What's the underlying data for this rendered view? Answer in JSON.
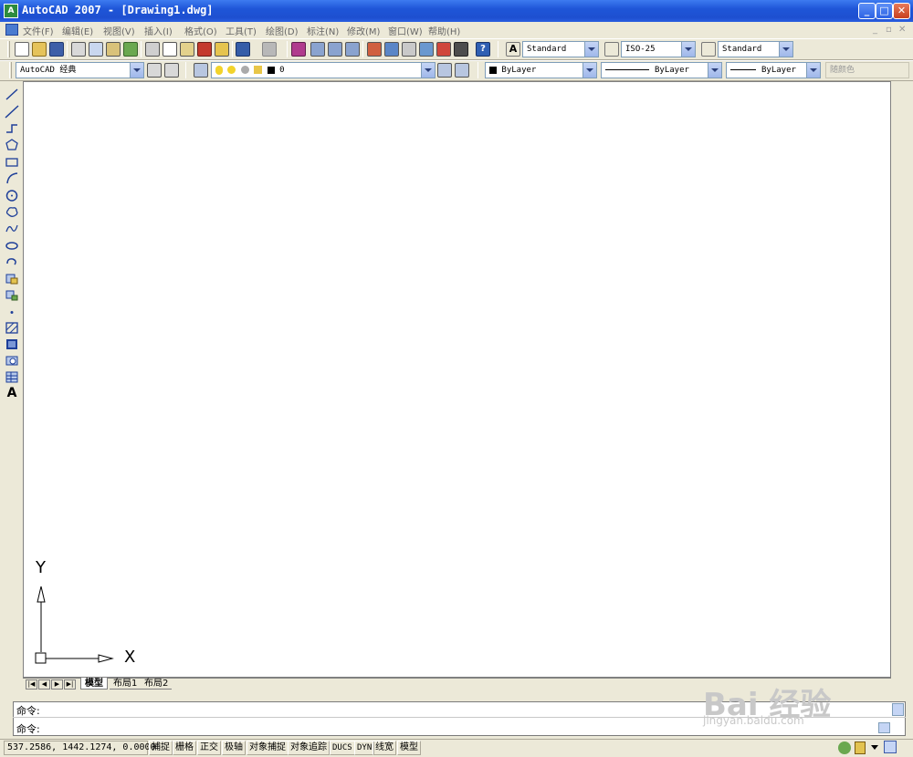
{
  "window": {
    "title": "AutoCAD 2007 - [Drawing1.dwg]"
  },
  "menu": {
    "items": [
      "文件(F)",
      "编辑(E)",
      "视图(V)",
      "插入(I)",
      "格式(O)",
      "工具(T)",
      "绘图(D)",
      "标注(N)",
      "修改(M)",
      "窗口(W)",
      "帮助(H)"
    ]
  },
  "styles_toolbar": {
    "text_style": "Standard",
    "dim_style": "ISO-25",
    "table_style": "Standard"
  },
  "workspace_toolbar": {
    "workspace": "AutoCAD 经典"
  },
  "layers_toolbar": {
    "current_layer": "0"
  },
  "properties_toolbar": {
    "color": "ByLayer",
    "linetype": "ByLayer",
    "lineweight": "ByLayer",
    "plot_style": "随颜色"
  },
  "ucs_icon": {
    "x_label": "X",
    "y_label": "Y"
  },
  "tabs": [
    "模型",
    "布局1",
    "布局2"
  ],
  "command": {
    "prompt1": "命令:",
    "prompt2": "命令:"
  },
  "status": {
    "coords": "537.2586,  1442.1274, 0.0000",
    "buttons": [
      "捕捉",
      "栅格",
      "正交",
      "极轴",
      "对象捕捉",
      "对象追踪",
      "DUCS",
      "DYN",
      "线宽",
      "模型"
    ]
  },
  "watermark": {
    "brand": "Bai 经验",
    "url": "jingyan.baidu.com"
  },
  "colors": {
    "title_bar": "#1f56d8",
    "chrome": "#ece9d8",
    "canvas": "#ffffff"
  }
}
